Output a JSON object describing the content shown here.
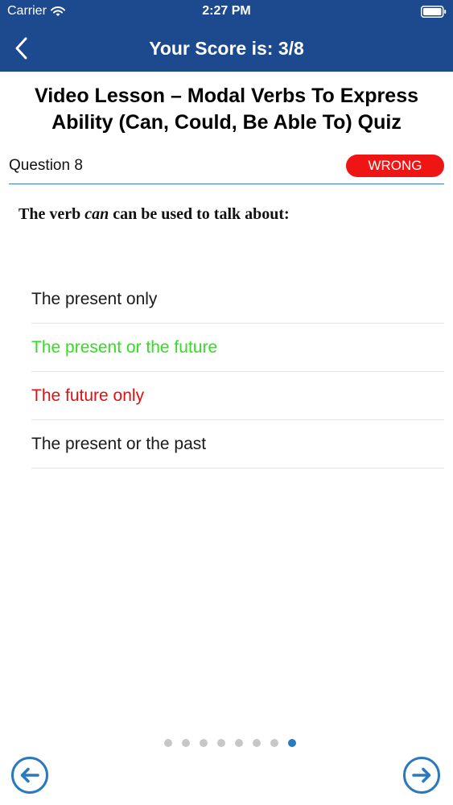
{
  "status_bar": {
    "carrier": "Carrier",
    "time": "2:27 PM",
    "wifi_icon": "wifi-icon",
    "battery_icon": "battery-icon"
  },
  "nav": {
    "title": "Your Score is: 3/8",
    "back_icon": "chevron-left-icon"
  },
  "quiz": {
    "title": "Video Lesson – Modal Verbs To Express Ability (Can, Could, Be Able To) Quiz",
    "question_label": "Question 8",
    "result": "WRONG",
    "question": {
      "before": "The verb ",
      "emphasis": "can",
      "after": " can be used to talk about:"
    },
    "answers": [
      {
        "text": "The present only",
        "state": "neutral"
      },
      {
        "text": "The present or the future",
        "state": "correct"
      },
      {
        "text": "The future only",
        "state": "wrong"
      },
      {
        "text": "The present or the past",
        "state": "neutral"
      }
    ]
  },
  "pager": {
    "total": 8,
    "current": 8
  },
  "footer": {
    "prev_icon": "arrow-left-circle-icon",
    "next_icon": "arrow-right-circle-icon"
  },
  "colors": {
    "header_bg": "#1d4a8f",
    "wrong_badge": "#f01515",
    "correct_text": "#33dd22",
    "wrong_text": "#e01010",
    "accent_blue": "#2a79bf"
  }
}
